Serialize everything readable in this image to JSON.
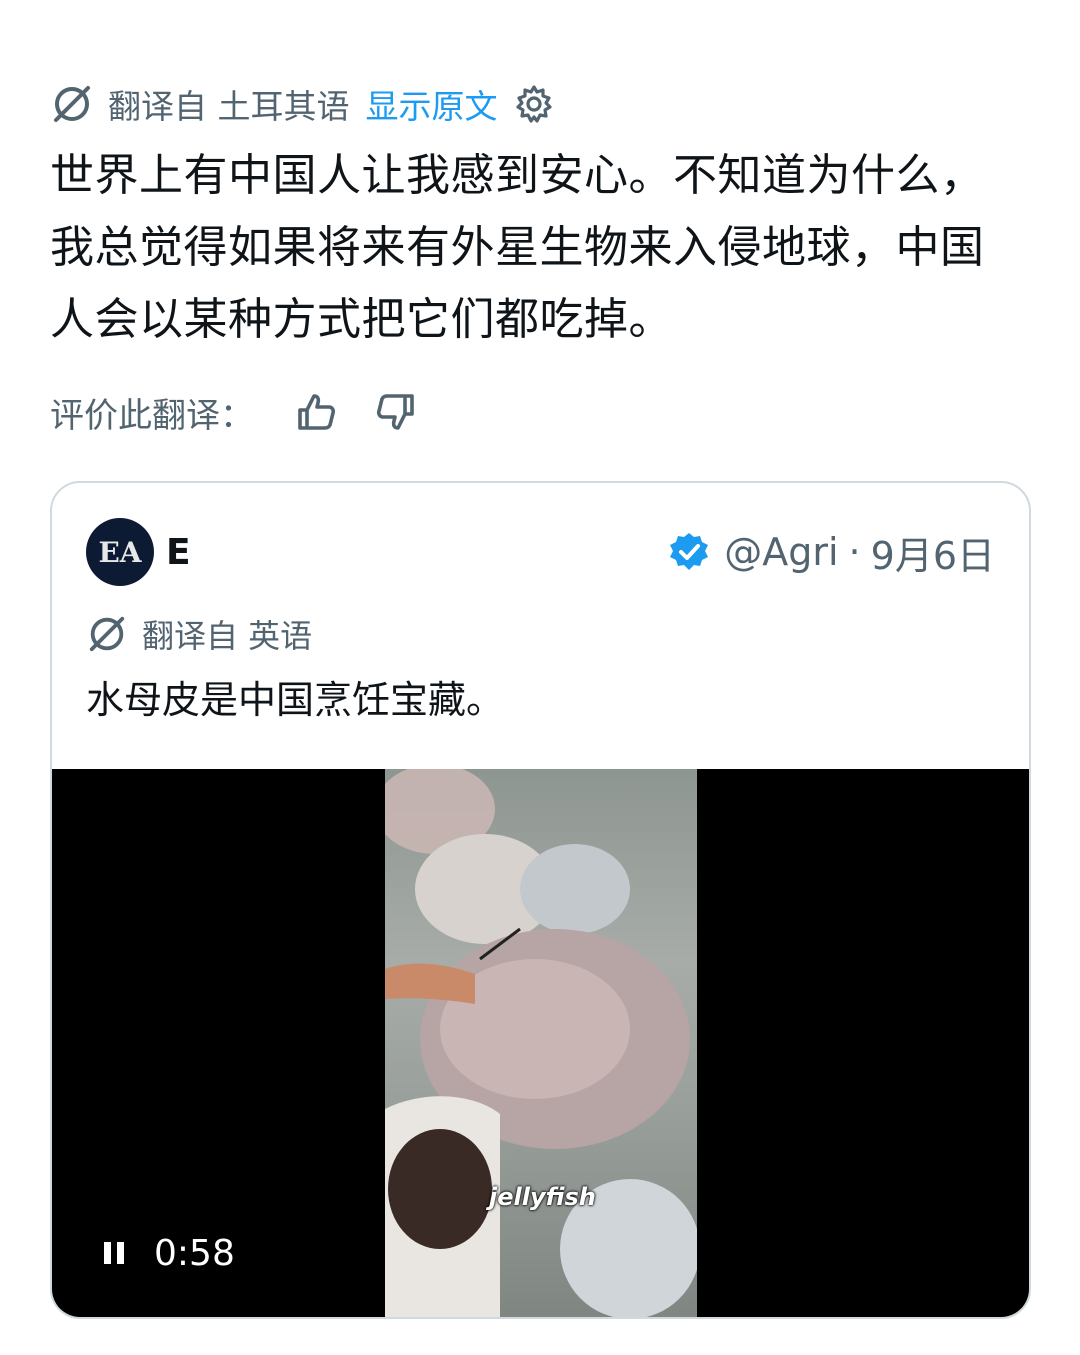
{
  "translation": {
    "label": "翻译自 土耳其语",
    "show_original": "显示原文"
  },
  "main_text": "世界上有中国人让我感到安心。不知道为什么，我总觉得如果将来有外星生物来入侵地球，中国人会以某种方式把它们都吃掉。",
  "rate": {
    "label": "评价此翻译："
  },
  "quote": {
    "avatar_text": "EA",
    "display_name": "E",
    "handle": "@Agri",
    "separator": "·",
    "date": "9月6日",
    "translated_label": "翻译自 英语",
    "text": "水母皮是中国烹饪宝藏。",
    "video": {
      "caption": "jellyfish",
      "timestamp": "0:58"
    }
  },
  "colors": {
    "accent": "#1d9bf0",
    "muted": "#536471",
    "border": "#cfd9de"
  }
}
